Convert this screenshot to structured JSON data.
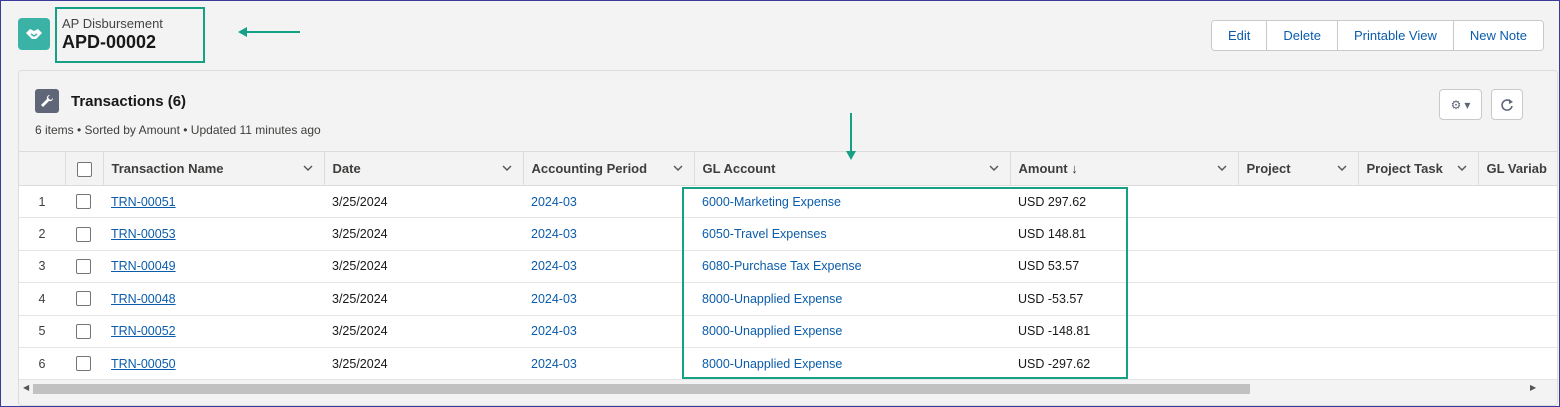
{
  "header": {
    "object_label": "AP Disbursement",
    "record_name": "APD-00002",
    "icon": "handshake-icon",
    "icon_color": "#3ab3a6",
    "actions": [
      "Edit",
      "Delete",
      "Printable View",
      "New Note"
    ]
  },
  "card": {
    "title": "Transactions (6)",
    "subtitle": "6 items • Sorted by Amount • Updated 11 minutes ago",
    "icon": "wrench-icon"
  },
  "table": {
    "columns": [
      "Transaction Name",
      "Date",
      "Accounting Period",
      "GL Account",
      "Amount ↓",
      "Project",
      "Project Task",
      "GL Variab"
    ],
    "rows": [
      {
        "num": "1",
        "name": "TRN-00051",
        "date": "3/25/2024",
        "period": "2024-03",
        "gl": "6000-Marketing Expense",
        "amount": "USD 297.62"
      },
      {
        "num": "2",
        "name": "TRN-00053",
        "date": "3/25/2024",
        "period": "2024-03",
        "gl": "6050-Travel Expenses",
        "amount": "USD 148.81"
      },
      {
        "num": "3",
        "name": "TRN-00049",
        "date": "3/25/2024",
        "period": "2024-03",
        "gl": "6080-Purchase Tax Expense",
        "amount": "USD 53.57"
      },
      {
        "num": "4",
        "name": "TRN-00048",
        "date": "3/25/2024",
        "period": "2024-03",
        "gl": "8000-Unapplied Expense",
        "amount": "USD -53.57"
      },
      {
        "num": "5",
        "name": "TRN-00052",
        "date": "3/25/2024",
        "period": "2024-03",
        "gl": "8000-Unapplied Expense",
        "amount": "USD -148.81"
      },
      {
        "num": "6",
        "name": "TRN-00050",
        "date": "3/25/2024",
        "period": "2024-03",
        "gl": "8000-Unapplied Expense",
        "amount": "USD -297.62"
      }
    ]
  },
  "colors": {
    "highlight": "#16a085",
    "link": "#0b5cab"
  }
}
